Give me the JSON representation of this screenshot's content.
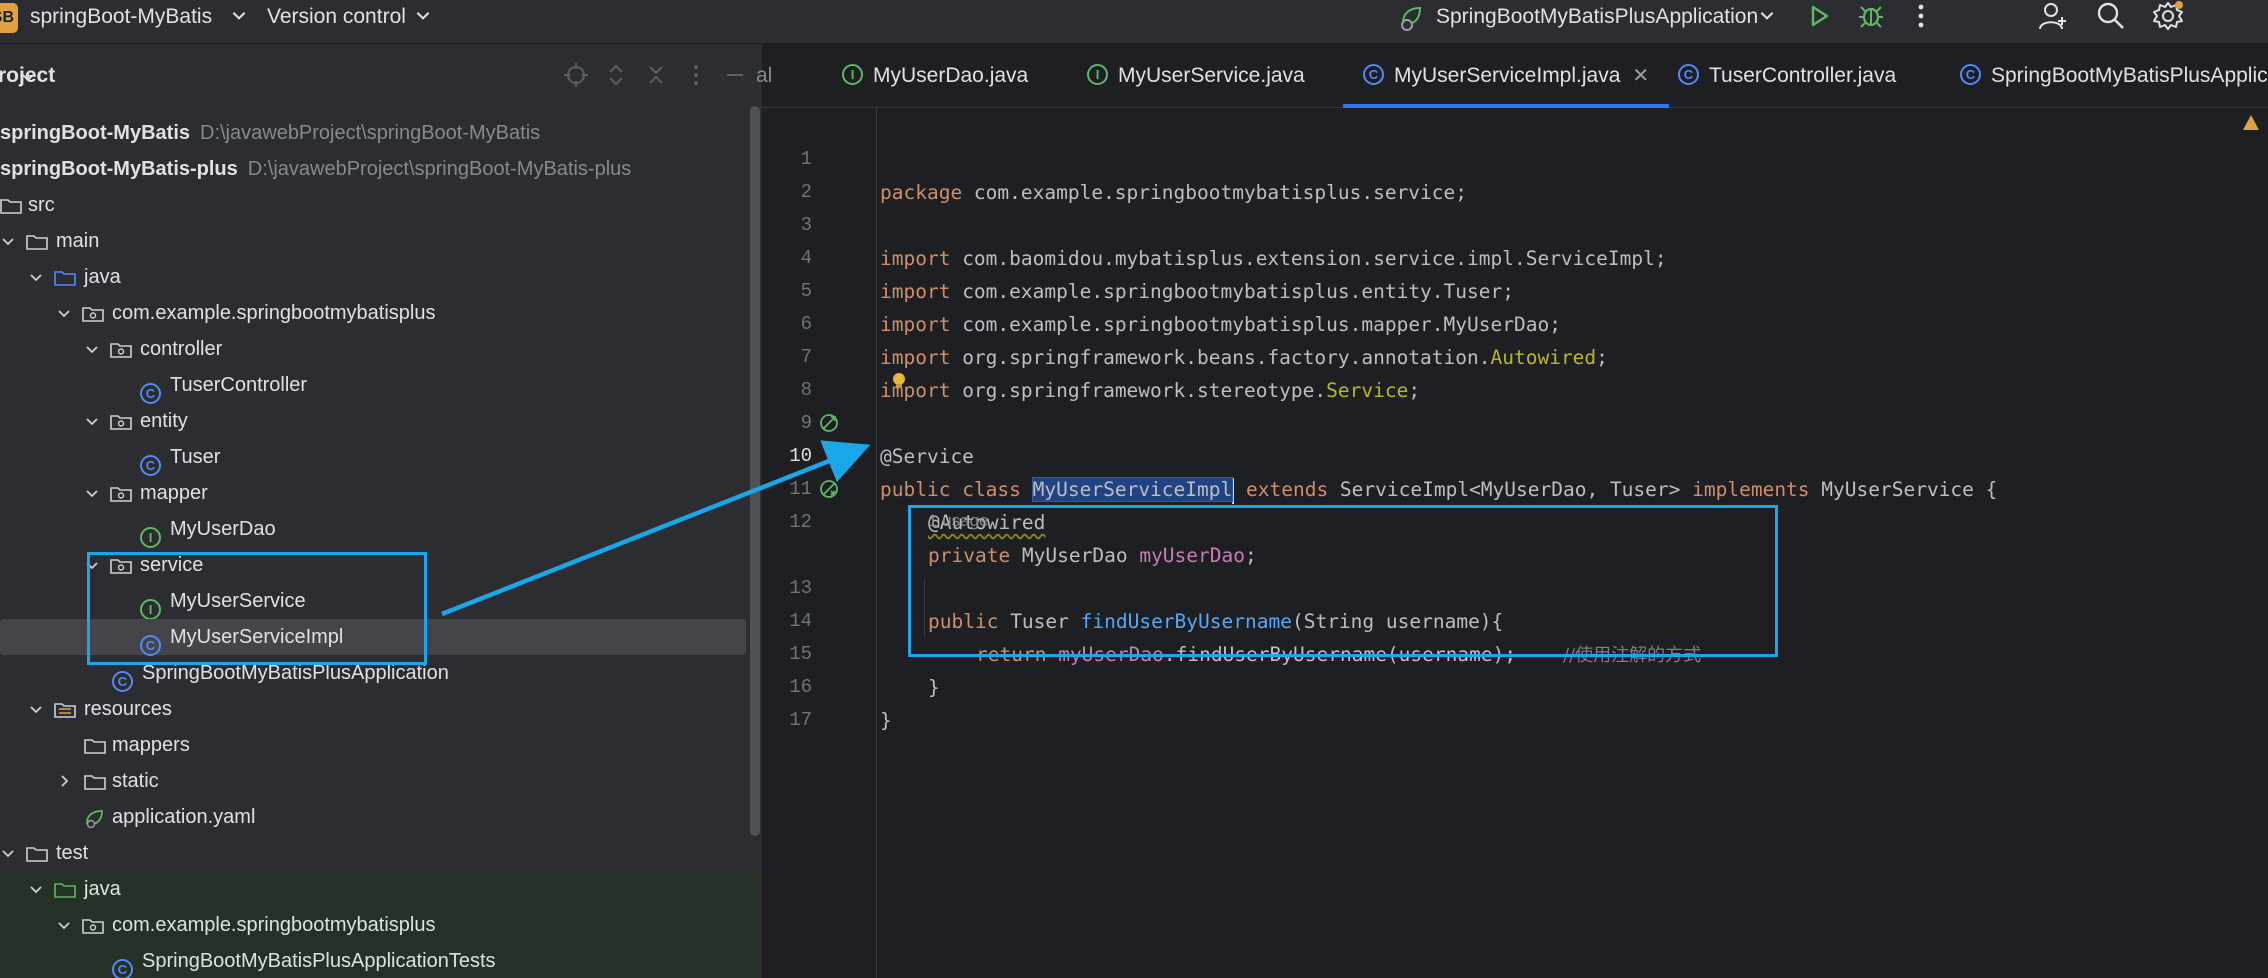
{
  "titlebar": {
    "badge": "SB",
    "project_name": "springBoot-MyBatis",
    "vcs_label": "Version control",
    "run_config": "SpringBootMyBatisPlusApplication",
    "icons": [
      "run-icon",
      "debug-icon",
      "more-icon",
      "add-user-icon",
      "search-icon",
      "settings-icon"
    ],
    "accent": "#e0a03d"
  },
  "project_panel": {
    "title": "Project",
    "items": [
      {
        "label": "springBoot-MyBatis",
        "path": "D:\\javawebProject\\springBoot-MyBatis",
        "bold": true
      },
      {
        "label": "springBoot-MyBatis-plus",
        "path": "D:\\javawebProject\\springBoot-MyBatis-plus",
        "bold": true
      },
      {
        "label": "src"
      },
      {
        "label": "main"
      },
      {
        "label": "java"
      },
      {
        "label": "com.example.springbootmybatisplus"
      },
      {
        "label": "controller"
      },
      {
        "label": "TuserController"
      },
      {
        "label": "entity"
      },
      {
        "label": "Tuser"
      },
      {
        "label": "mapper"
      },
      {
        "label": "MyUserDao"
      },
      {
        "label": "service"
      },
      {
        "label": "MyUserService"
      },
      {
        "label": "MyUserServiceImpl",
        "selected": true
      },
      {
        "label": "SpringBootMyBatisPlusApplication"
      },
      {
        "label": "resources"
      },
      {
        "label": "mappers"
      },
      {
        "label": "static"
      },
      {
        "label": "application.yaml"
      },
      {
        "label": "test"
      },
      {
        "label": "java"
      },
      {
        "label": "com.example.springbootmybatisplus"
      },
      {
        "label": "SpringBootMyBatisPlusApplicationTests"
      }
    ]
  },
  "tabs": [
    {
      "label": "MyUserDao.java",
      "kind": "interface"
    },
    {
      "label": "MyUserService.java",
      "kind": "interface"
    },
    {
      "label": "MyUserServiceImpl.java",
      "kind": "class",
      "active": true
    },
    {
      "label": "TuserController.java",
      "kind": "class"
    },
    {
      "label": "SpringBootMyBatisPlusApplic",
      "kind": "class"
    }
  ],
  "editor": {
    "line_numbers": [
      "1",
      "2",
      "3",
      "4",
      "5",
      "6",
      "7",
      "8",
      "9",
      "10",
      "11",
      "12",
      "13",
      "14",
      "15",
      "16",
      "17"
    ],
    "usage_hint": "1 usage",
    "code": {
      "l1_pkg": "package",
      "l1_rest": " com.example.springbootmybatisplus.service;",
      "import": "import",
      "l3": " com.baomidou.mybatisplus.extension.service.impl.ServiceImpl;",
      "l4": " com.example.springbootmybatisplus.entity.Tuser;",
      "l5": " com.example.springbootmybatisplus.mapper.MyUserDao;",
      "l6_a": " org.springframework.beans.factory.annotation.",
      "l6_b": "Autowired",
      "l7_a": " org.springframework.stereotype.",
      "l7_b": "Service",
      "l9": "@Service",
      "l10_public": "public",
      "l10_class": "class",
      "l10_name": "MyUserServiceImpl",
      "l10_extends": "extends",
      "l10_super": " ServiceImpl<MyUserDao, Tuser> ",
      "l10_impl": "implements",
      "l10_iface": " MyUserService {",
      "l11": "@Autowired",
      "l12_private": "private",
      "l12_type": " MyUserDao ",
      "l12_field": "myUserDao",
      "l12_end": ";",
      "l13_public": "public",
      "l13_type": " Tuser ",
      "l13_method": "findUserByUsername",
      "l13_args": "(String username){",
      "l14_return": "return",
      "l14_field": "myUserDao",
      "l14_call": ".findUserByUsername(username);",
      "l14_comment": "//使用注解的方式",
      "l15": "}",
      "l16": "}"
    }
  },
  "colors": {
    "annotation_box": "#1aa6e8",
    "selection": "#214283",
    "keyword": "#cf8e6d"
  }
}
